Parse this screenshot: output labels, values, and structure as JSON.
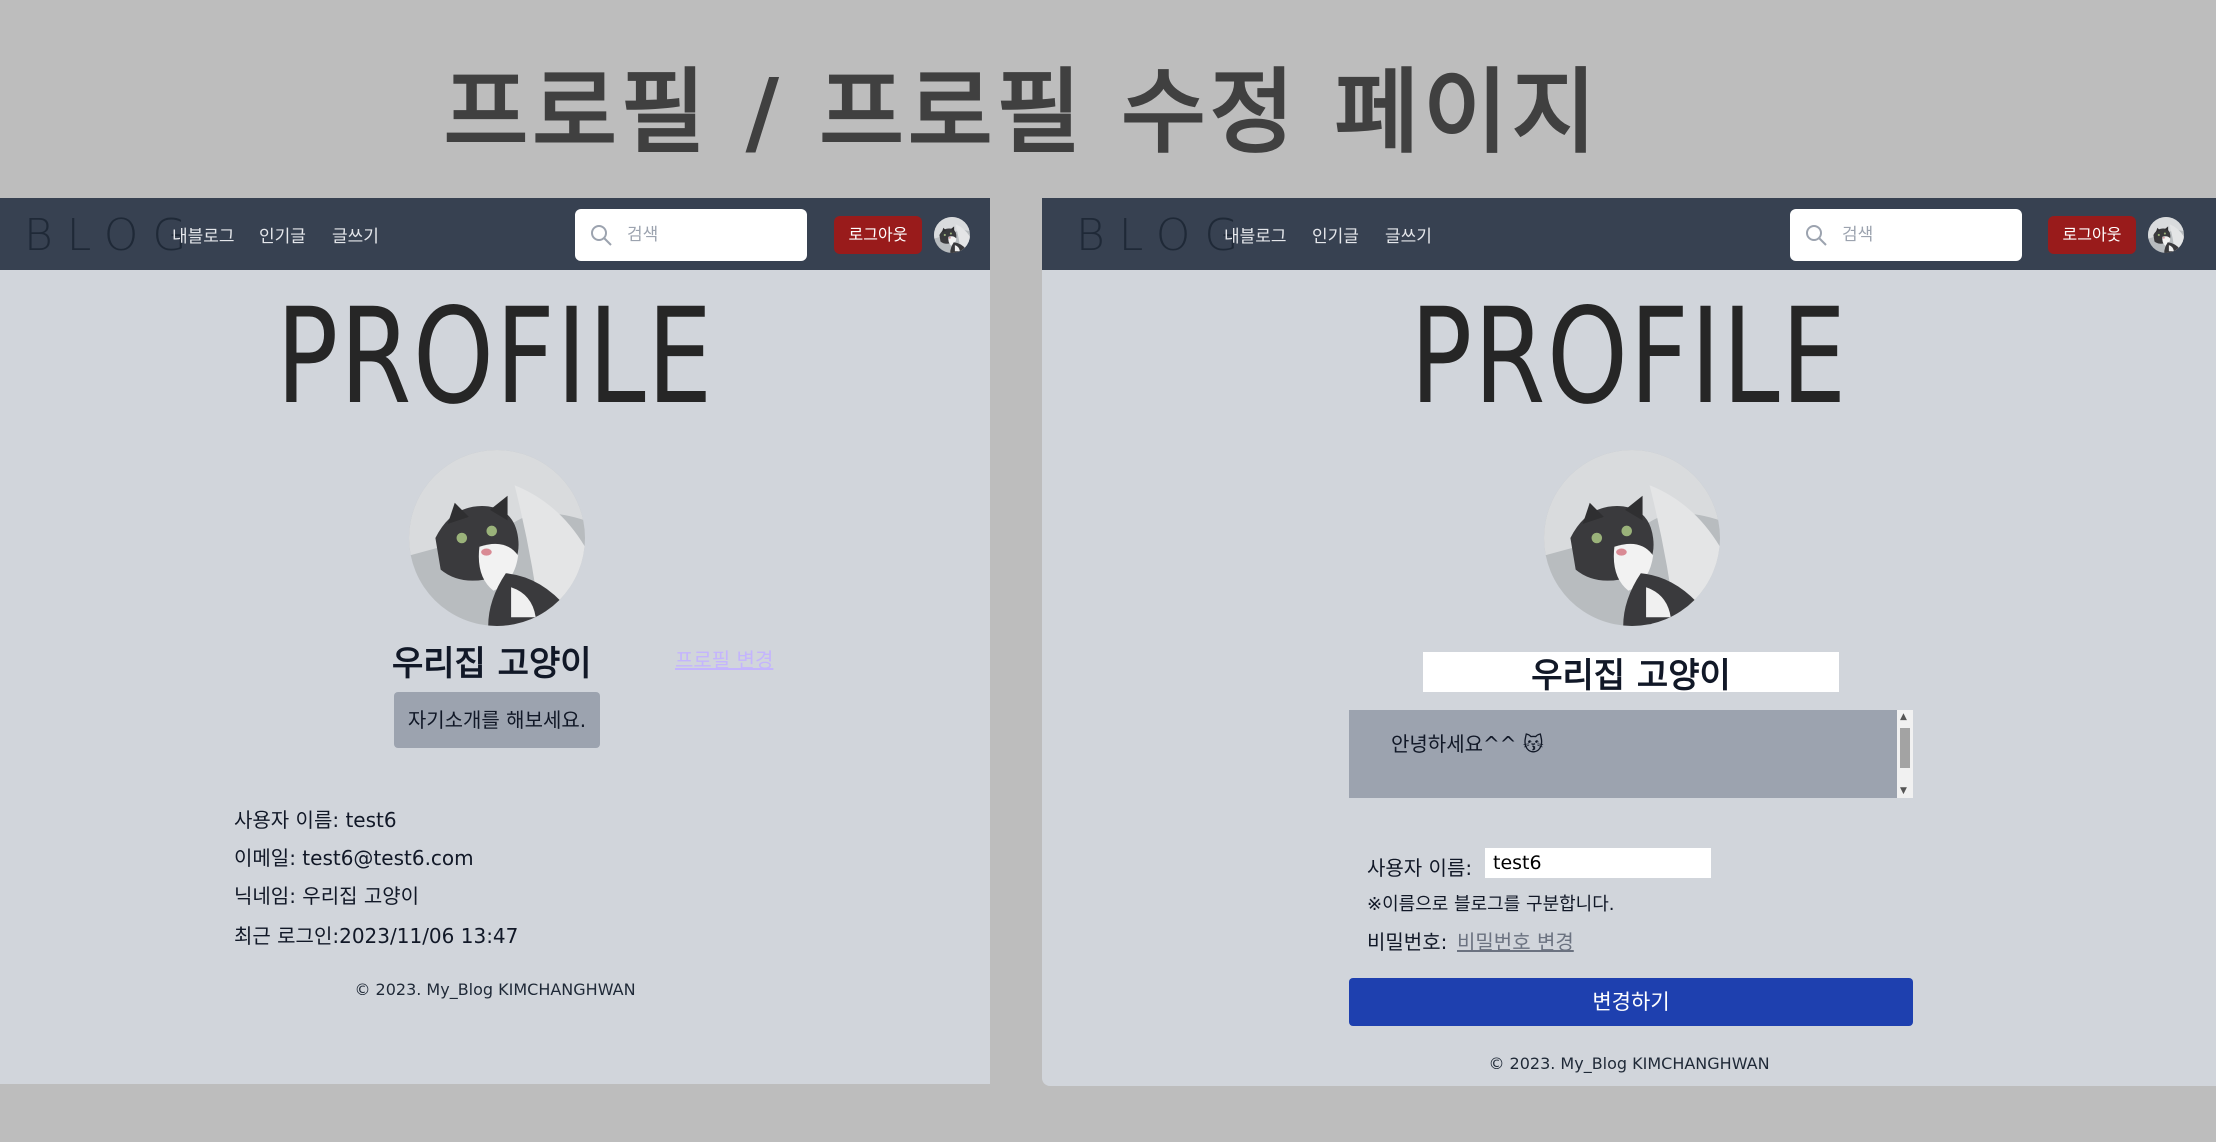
{
  "heading": "프로필 / 프로필 수정 페이지",
  "navbar": {
    "logo": "BLOG",
    "links": [
      "내블로그",
      "인기글",
      "글쓰기"
    ],
    "search_placeholder": "검색",
    "logout_label": "로그아웃"
  },
  "profile_view": {
    "title": "PROFILE",
    "nickname": "우리집 고양이",
    "edit_link": "프로필 변경",
    "intro": "자기소개를 해보세요.",
    "info": [
      {
        "label": "사용자 이름: ",
        "value": "test6"
      },
      {
        "label": "이메일: ",
        "value": "test6@test6.com"
      },
      {
        "label": "닉네임: ",
        "value": "우리집 고양이"
      },
      {
        "label": "최근 로그인:",
        "value": "2023/11/06 13:47"
      }
    ],
    "footer": "© 2023. My_Blog KIMCHANGHWAN"
  },
  "profile_edit": {
    "title": "PROFILE",
    "nickname_value": "우리집 고양이",
    "intro_value": "안녕하세요^^ 😽",
    "username_label": "사용자 이름:",
    "username_value": "test6",
    "username_note": "※이름으로 블로그를 구분합니다.",
    "password_label": "비밀번호:",
    "password_link": "비밀번호 변경",
    "submit_label": "변경하기",
    "footer": "© 2023. My_Blog KIMCHANGHWAN"
  },
  "colors": {
    "background": "#bdbdbd",
    "panel": "#d1d5db",
    "navbar": "#374151",
    "logout": "#991b1b",
    "submit": "#1e40af"
  }
}
